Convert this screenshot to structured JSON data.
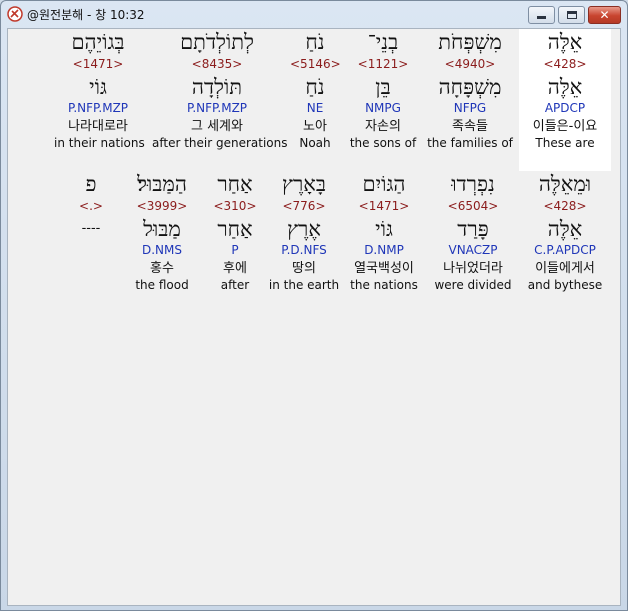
{
  "window": {
    "title": "@원전분해 - 창 10:32",
    "minimize_label": "",
    "maximize_label": "",
    "close_label": "✕"
  },
  "rows": [
    {
      "words": [
        {
          "heb": "אֵלֶּה",
          "strong": "<428>",
          "lex": "אֵלֶּה",
          "parse": "APDCP",
          "kor": "이들은-이요",
          "eng": "These are"
        },
        {
          "heb": "מִשְׁפְּחֹת",
          "strong": "<4940>",
          "lex": "מִשְׁפָּחָה",
          "parse": "NFPG",
          "kor": "족속들",
          "eng": "the families of"
        },
        {
          "heb": "בְנֵי־",
          "strong": "<1121>",
          "lex": "בֵּן",
          "parse": "NMPG",
          "kor": "자손의",
          "eng": "the sons of"
        },
        {
          "heb": "נֹחַ",
          "strong": "<5146>",
          "lex": "נֹחַ",
          "parse": "NE",
          "kor": "노아",
          "eng": "Noah"
        },
        {
          "heb": "לְתוֹלְדֹתָם",
          "strong": "<8435>",
          "lex": "תּוֹלְדָה",
          "parse": "P.NFP.MZP",
          "kor": "그 세계와",
          "eng": "after their generations"
        },
        {
          "heb": "בְּגוֹיֵהֶם",
          "strong": "<1471>",
          "lex": "גּוֹי",
          "parse": "P.NFP.MZP",
          "kor": "나라대로라",
          "eng": "in their nations"
        }
      ]
    },
    {
      "words": [
        {
          "heb": "וּמֵאֵלֶּה",
          "strong": "<428>",
          "lex": "אֵלֶּה",
          "parse": "C.P.APDCP",
          "kor": "이들에게서",
          "eng": "and bythese"
        },
        {
          "heb": "נִפְרְדוּ",
          "strong": "<6504>",
          "lex": "פָּרַד",
          "parse": "VNACZP",
          "kor": "나뉘었더라",
          "eng": "were divided"
        },
        {
          "heb": "הַגּוֹיִם",
          "strong": "<1471>",
          "lex": "גּוֹי",
          "parse": "D.NMP",
          "kor": "열국백성이",
          "eng": "the nations"
        },
        {
          "heb": "בָּאָרֶץ",
          "strong": "<776>",
          "lex": "אֶרֶץ",
          "parse": "P.D.NFS",
          "kor": "땅의",
          "eng": "in the earth"
        },
        {
          "heb": "אַחַר",
          "strong": "<310>",
          "lex": "אַחַר",
          "parse": "P",
          "kor": "후에",
          "eng": "after"
        },
        {
          "heb": "הַמַּבּוּל׃",
          "strong": "<3999>",
          "lex": "מַבּוּל",
          "parse": "D.NMS",
          "kor": "홍수",
          "eng": "the flood"
        },
        {
          "heb": "פ",
          "strong": "<.>",
          "lex": "----",
          "parse": "",
          "kor": "",
          "eng": ""
        }
      ]
    }
  ]
}
